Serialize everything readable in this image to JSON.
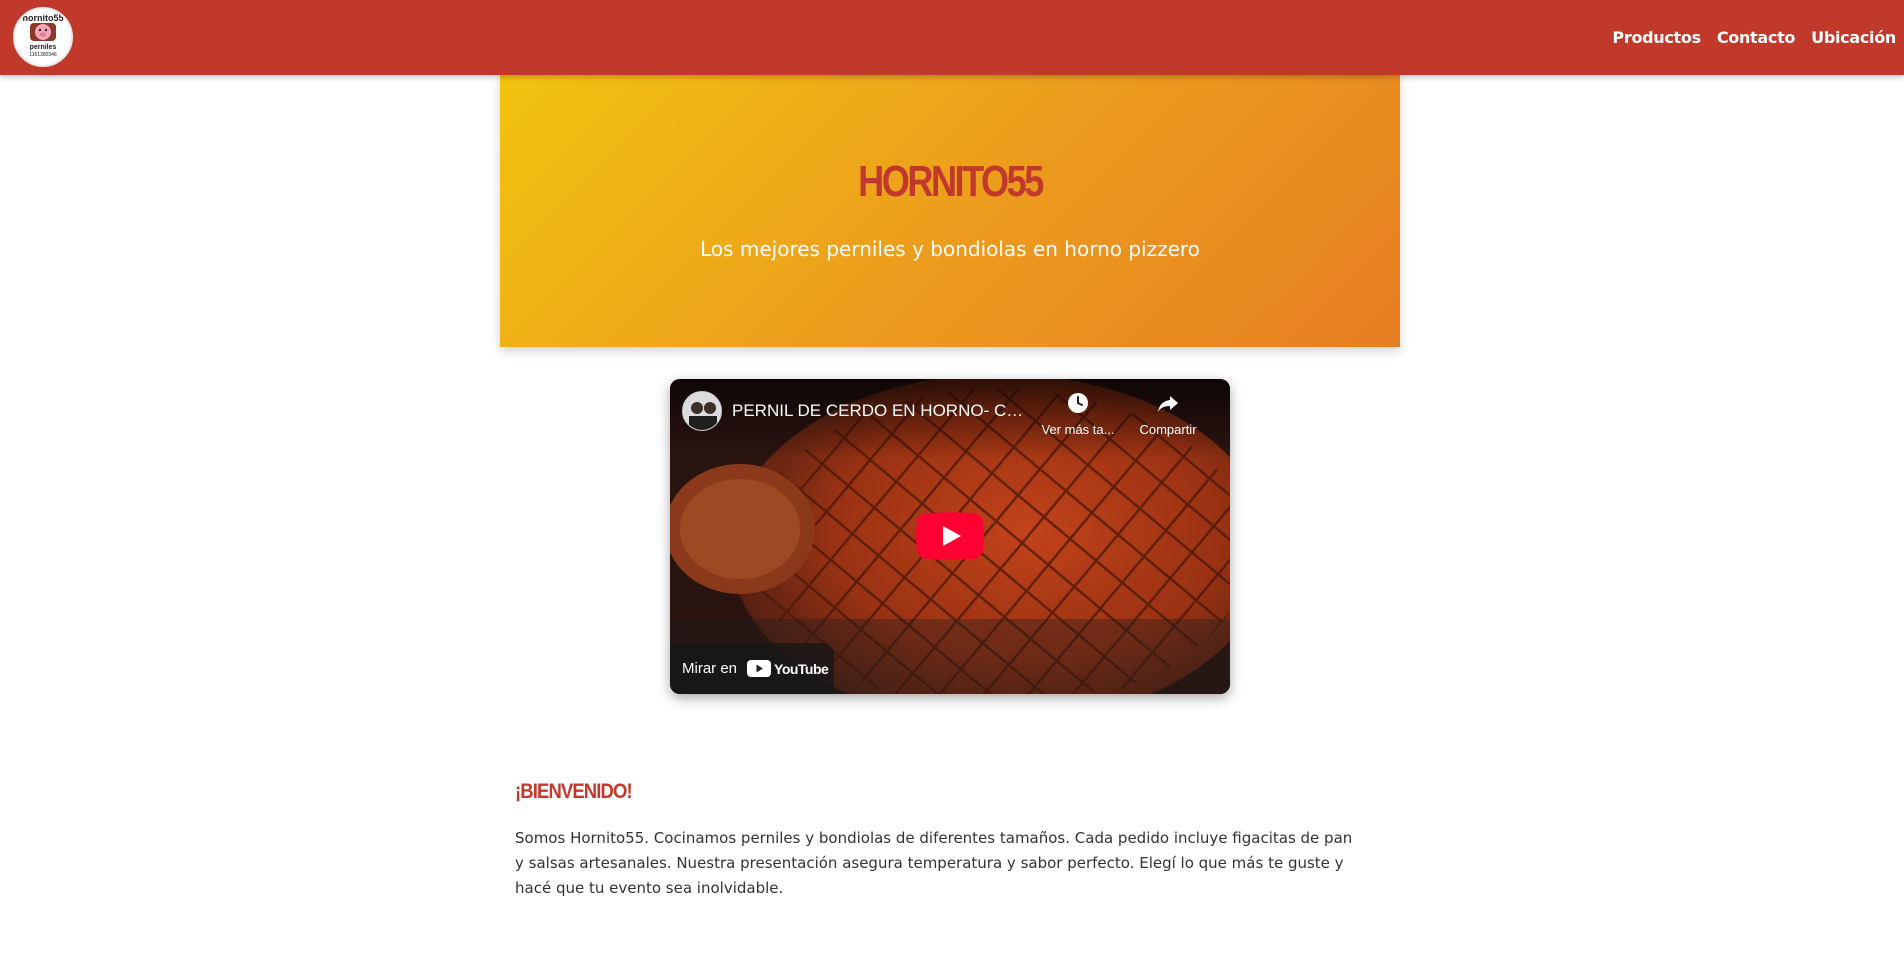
{
  "header": {
    "logo_alt": "hornito55 perniles",
    "logo_text_top": "hornito55",
    "logo_text_bottom": "perniles",
    "logo_phone": "1161380346",
    "nav": [
      {
        "label": "Productos"
      },
      {
        "label": "Contacto"
      },
      {
        "label": "Ubicación"
      }
    ],
    "colors": {
      "bar": "#c0392b",
      "nav_text": "#ffffff"
    }
  },
  "hero": {
    "title": "HORNITO55",
    "subtitle": "Los mejores perniles y bondiolas en horno pizzero",
    "colors": {
      "gradient_start": "#f1c40f",
      "gradient_end": "#e67e22",
      "title": "#c0392b"
    }
  },
  "video": {
    "title": "PERNIL DE CERDO EN HORNO- CO...",
    "watch_later_label": "Ver más ta...",
    "share_label": "Compartir",
    "watch_on_label": "Mirar en",
    "youtube_label": "YouTube",
    "icons": [
      "clock-icon",
      "share-icon",
      "play-icon",
      "youtube-logo-icon"
    ]
  },
  "welcome": {
    "title": "¡BIENVENIDO!",
    "text": "Somos Hornito55. Cocinamos perniles y bondiolas de diferentes tamaños. Cada pedido incluye figacitas de pan y salsas artesanales. Nuestra presentación asegura temperatura y sabor perfecto. Elegí lo que más te guste y hacé que tu evento sea inolvidable."
  }
}
